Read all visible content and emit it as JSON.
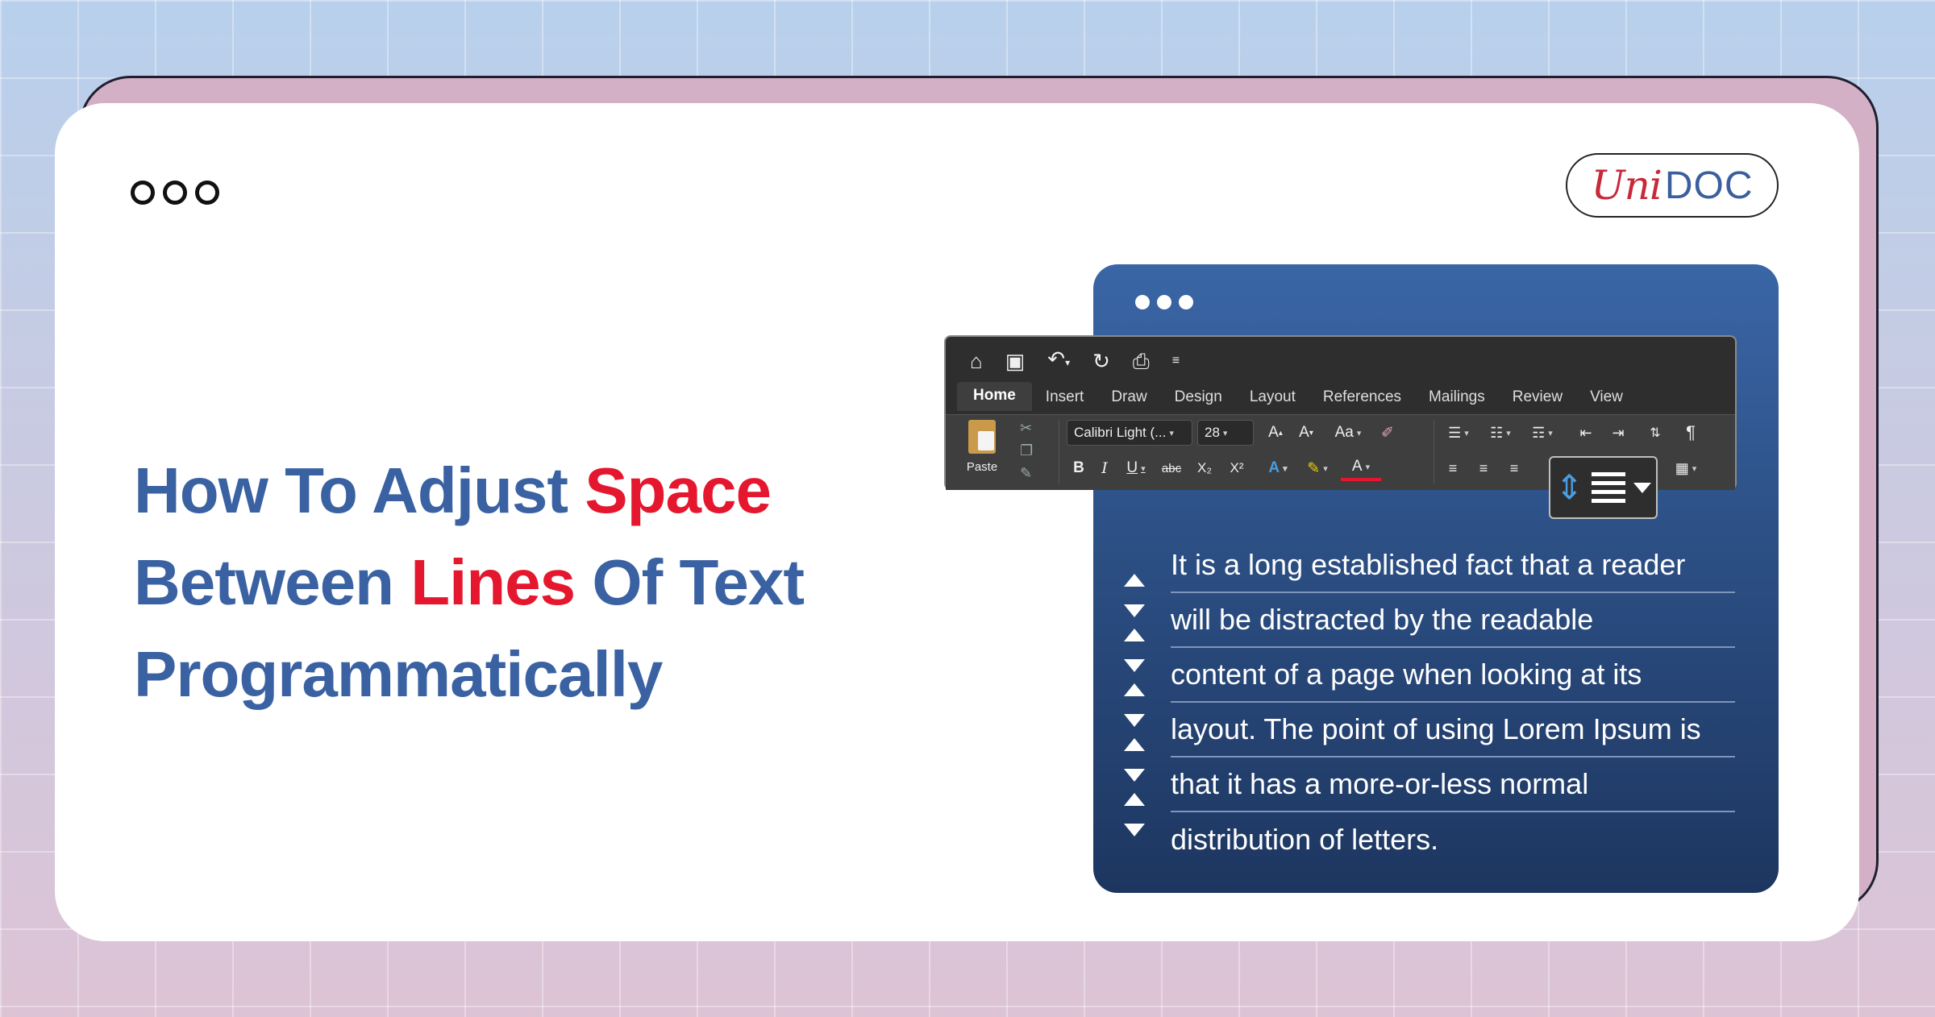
{
  "headline": {
    "line1_prefix": "How To Adjust ",
    "line1_highlight": "Space",
    "line2_prefix": "Between ",
    "line2_highlight": "Lines",
    "line2_suffix": " Of Text",
    "line3": "Programmatically"
  },
  "logo": {
    "uni": "Uni",
    "doc": "DOC"
  },
  "ribbon": {
    "qat_icons": [
      "home-icon",
      "save-icon",
      "undo-icon",
      "redo-icon",
      "print-icon",
      "customize-icon"
    ],
    "tabs": [
      "Home",
      "Insert",
      "Draw",
      "Design",
      "Layout",
      "References",
      "Mailings",
      "Review",
      "View"
    ],
    "paste_label": "Paste",
    "font_name": "Calibri Light (...",
    "font_size": "28",
    "format_buttons": {
      "bold": "B",
      "italic": "I",
      "underline": "U",
      "strikethrough": "abc",
      "subscript": "X₂",
      "superscript": "X²",
      "font_color": "A",
      "grow_font": "A",
      "shrink_font": "A",
      "change_case": "Aa",
      "pilcrow": "¶"
    }
  },
  "paragraph": {
    "lines": [
      "It is a long established fact that a reader",
      "will be distracted by the readable",
      "content of a page when looking at its",
      "layout. The point of using Lorem Ipsum is",
      "that it has a more-or-less normal",
      "distribution of letters."
    ]
  },
  "colors": {
    "headline_blue": "#3a62a2",
    "headline_red": "#e4172e",
    "panel_blue": "#2c4f84",
    "logo_red": "#c8283a",
    "logo_blue": "#3a5f9c"
  }
}
